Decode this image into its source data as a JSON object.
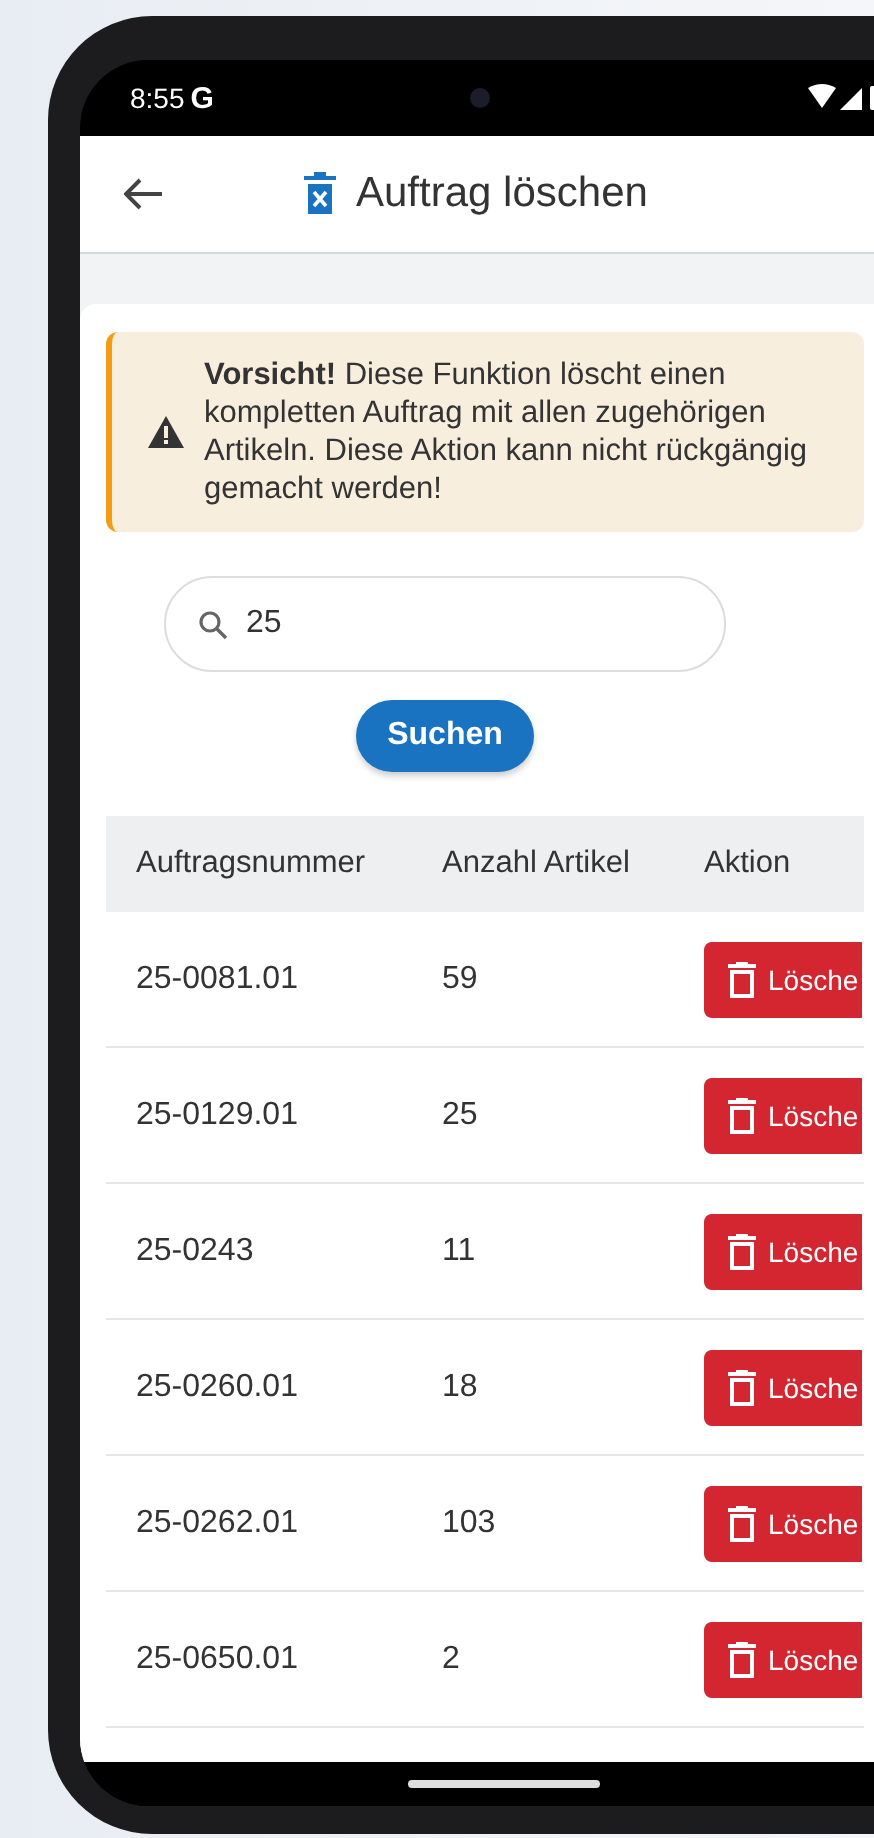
{
  "status_bar": {
    "time": "8:55",
    "badge": "G"
  },
  "app_bar": {
    "title": "Auftrag löschen"
  },
  "warning": {
    "text": "**Vorsicht!** Diese Funktion löscht einen kompletten Auftrag mit allen zugehörigen Artikeln. Diese Aktion kann nicht rückgängig gemacht werden!"
  },
  "search": {
    "value": "25"
  },
  "search_button": "Suchen",
  "table": {
    "columns": [
      "Auftragsnummer",
      "Anzahl Artikel",
      "Aktion"
    ],
    "rows": [
      {
        "order": "25-0081.01",
        "count": "59",
        "action": "Lösche"
      },
      {
        "order": "25-0129.01",
        "count": "25",
        "action": "Lösche"
      },
      {
        "order": "25-0243",
        "count": "11",
        "action": "Lösche"
      },
      {
        "order": "25-0260.01",
        "count": "18",
        "action": "Lösche"
      },
      {
        "order": "25-0262.01",
        "count": "103",
        "action": "Lösche"
      },
      {
        "order": "25-0650.01",
        "count": "2",
        "action": "Lösche"
      }
    ]
  }
}
